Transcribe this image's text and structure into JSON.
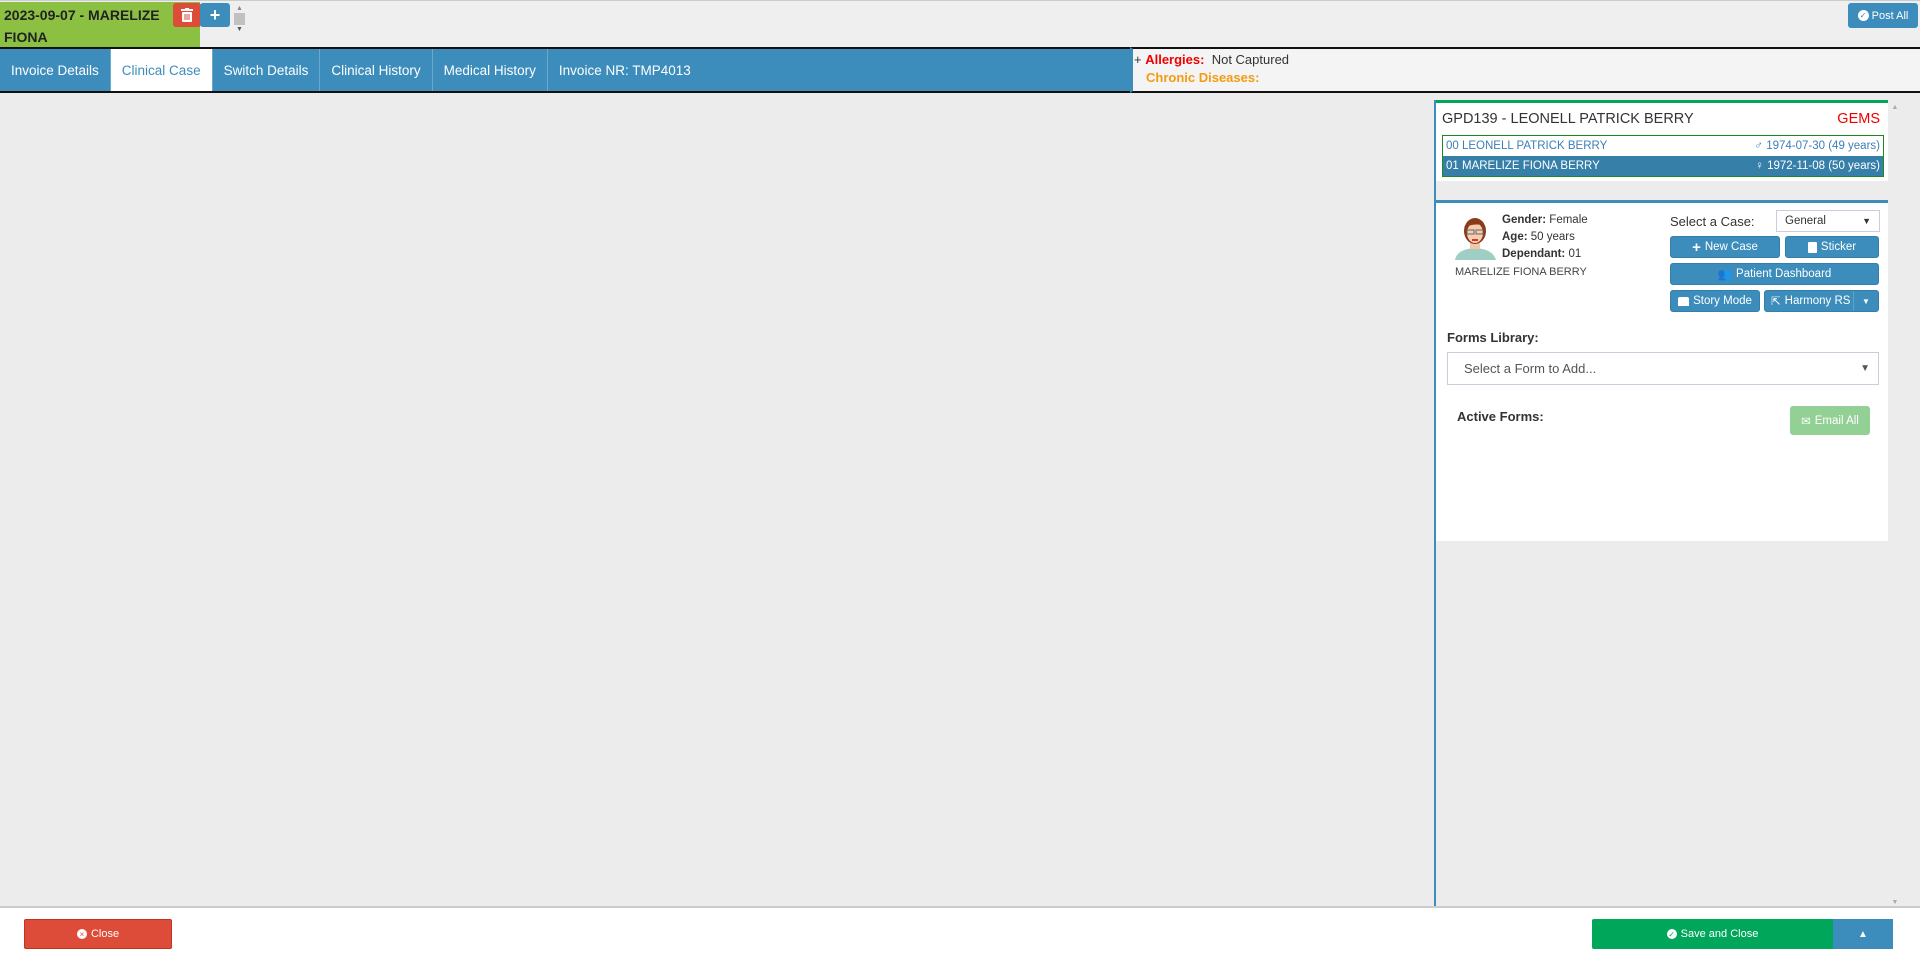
{
  "header": {
    "patient_tab": "2023-09-07 - MARELIZE FIONA",
    "post_all": "Post All"
  },
  "tabs": [
    {
      "label": "Invoice Details"
    },
    {
      "label": "Clinical Case"
    },
    {
      "label": "Switch Details"
    },
    {
      "label": "Clinical History"
    },
    {
      "label": "Medical History"
    },
    {
      "label": "Invoice NR: TMP4013"
    }
  ],
  "alerts": {
    "plus": "+",
    "allergies_label": "Allergies:",
    "allergies_value": "Not Captured",
    "chronic_label": "Chronic Diseases:"
  },
  "family": {
    "title": "GPD139 - LEONELL PATRICK BERRY",
    "scheme": "GEMS",
    "members": [
      {
        "name": "00 LEONELL PATRICK BERRY",
        "gender_icon": "male-icon",
        "dob": "1974-07-30 (49 years)"
      },
      {
        "name": "01 MARELIZE FIONA BERRY",
        "gender_icon": "female-icon",
        "dob": "1972-11-08 (50 years)"
      }
    ]
  },
  "patient": {
    "gender_label": "Gender:",
    "gender": "Female",
    "age_label": "Age:",
    "age": "50 years",
    "dependant_label": "Dependant:",
    "dependant": "01",
    "name": "MARELIZE FIONA BERRY",
    "select_case_label": "Select a Case:",
    "case_value": "General",
    "new_case": "New Case",
    "sticker": "Sticker",
    "dashboard": "Patient Dashboard",
    "story_mode": "Story Mode",
    "harmony": "Harmony RS",
    "forms_library_label": "Forms Library:",
    "forms_placeholder": "Select a Form to Add...",
    "active_forms_label": "Active Forms:",
    "email_all": "Email All"
  },
  "footer": {
    "close": "Close",
    "save_close": "Save and Close"
  },
  "colors": {
    "primary": "#3c8dbc",
    "danger": "#dd4b39",
    "success": "#00a65a",
    "patient_tab": "#8bc043"
  }
}
